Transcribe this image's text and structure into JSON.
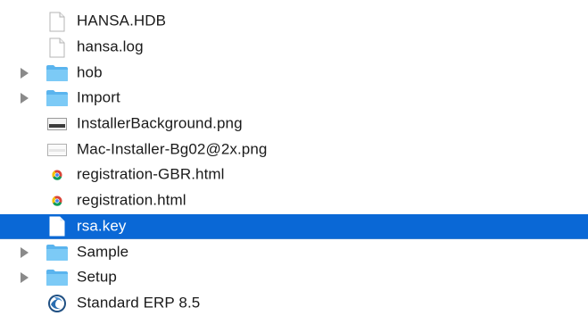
{
  "files": [
    {
      "name": "HANSA.HDB",
      "type": "document",
      "expandable": false,
      "selected": false
    },
    {
      "name": "hansa.log",
      "type": "document",
      "expandable": false,
      "selected": false
    },
    {
      "name": "hob",
      "type": "folder",
      "expandable": true,
      "selected": false
    },
    {
      "name": "Import",
      "type": "folder",
      "expandable": true,
      "selected": false
    },
    {
      "name": "InstallerBackground.png",
      "type": "image",
      "expandable": false,
      "selected": false
    },
    {
      "name": "Mac-Installer-Bg02@2x.png",
      "type": "image",
      "expandable": false,
      "selected": false
    },
    {
      "name": "registration-GBR.html",
      "type": "html",
      "expandable": false,
      "selected": false
    },
    {
      "name": "registration.html",
      "type": "html",
      "expandable": false,
      "selected": false
    },
    {
      "name": "rsa.key",
      "type": "document",
      "expandable": false,
      "selected": true
    },
    {
      "name": "Sample",
      "type": "folder",
      "expandable": true,
      "selected": false
    },
    {
      "name": "Setup",
      "type": "folder",
      "expandable": true,
      "selected": false
    },
    {
      "name": "Standard ERP 8.5",
      "type": "application",
      "expandable": false,
      "selected": false
    }
  ],
  "colors": {
    "selection": "#0a68d6",
    "folder": "#6ec3f4",
    "disclosure": "#8a8a8a"
  }
}
